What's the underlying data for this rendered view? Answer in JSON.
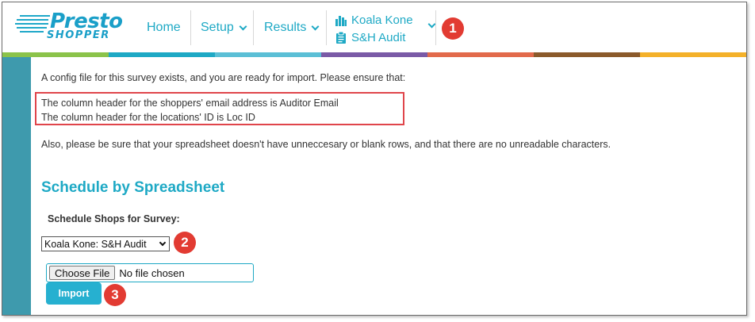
{
  "logo": {
    "word1": "Presto",
    "word2": "SHOPPER"
  },
  "nav": {
    "home": "Home",
    "setup": "Setup",
    "results": "Results",
    "survey_client": "Koala Kone",
    "survey_name": "S&H Audit"
  },
  "callouts": {
    "one": "1",
    "two": "2",
    "three": "3"
  },
  "colors": {
    "brand": "#1ea9c5",
    "sidebar": "#3e9aad",
    "callout": "#e23b32",
    "highlight_border": "#e0454b",
    "colorbar": [
      "#8bc34a",
      "#1ea9c5",
      "#3ab4d0",
      "#6e5aa8",
      "#e26a4b",
      "#a0522d",
      "#f4b12a"
    ]
  },
  "content": {
    "intro": "A config file for this survey exists, and you are ready for import. Please ensure that:",
    "email_header_line": "The column header for the shoppers' email address is Auditor Email",
    "location_header_line": "The column header for the locations' ID is Loc ID",
    "also_note": "Also, please be sure that your spreadsheet doesn't have unneccesary or blank rows, and that there are no unreadable characters.",
    "section_title": "Schedule by Spreadsheet",
    "survey_label": "Schedule Shops for Survey:",
    "survey_select_value": "Koala Kone: S&H Audit",
    "choose_file_label": "Choose File",
    "no_file_text": "No file chosen",
    "import_label": "Import"
  }
}
